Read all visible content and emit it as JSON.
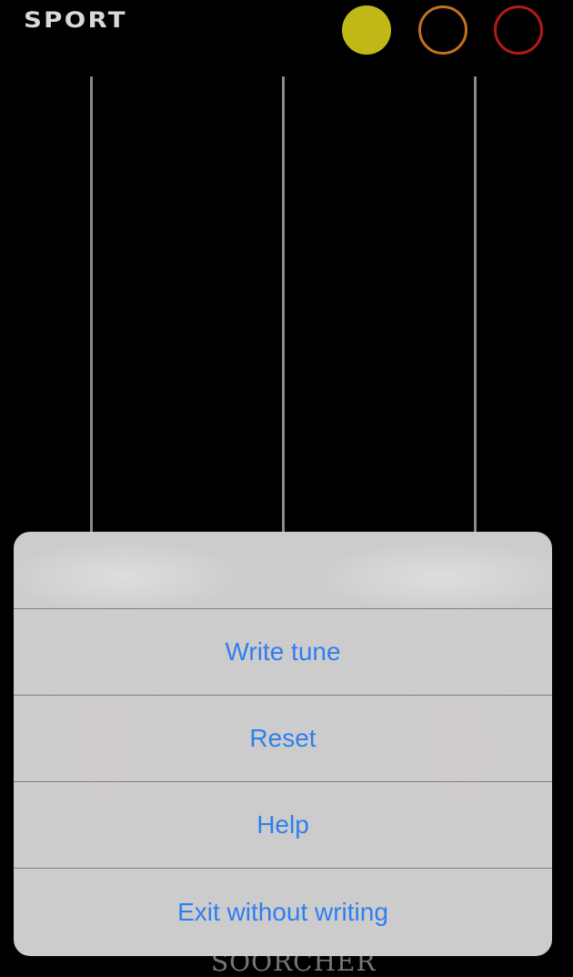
{
  "screen": {
    "mode_label": "SPORT",
    "background_logo_text": "SOORCHER"
  },
  "indicators": [
    {
      "name": "indicator-1",
      "state": "filled",
      "color": "#bfb817"
    },
    {
      "name": "indicator-2",
      "state": "outline",
      "color": "#c4701f"
    },
    {
      "name": "indicator-3",
      "state": "outline",
      "color": "#b51a16"
    }
  ],
  "action_sheet": {
    "actions": [
      {
        "label": "Write tune"
      },
      {
        "label": "Reset"
      },
      {
        "label": "Help"
      },
      {
        "label": "Exit without writing"
      }
    ],
    "action_color": "#2f7ef0"
  }
}
